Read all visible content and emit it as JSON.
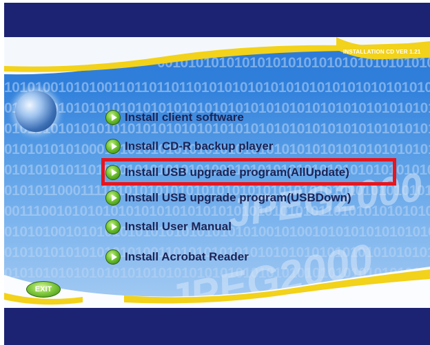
{
  "installer": {
    "version_label": "INSTALLATION CD VER 1.21",
    "watermark_text": "JPEG2000",
    "binary_lines": [
      "0010101010101010101010101010101010101010101010",
      "1010100101010011011011011010101010101010101010101010101010",
      "010101010101010101010101010101010101010101010101010101010101",
      "010101010101010101010101010101010101010101010101010101010101",
      "010101010100010101010101010101010101010101010101010101010101",
      "010101010110101010101010101000101010101010101010101010101010",
      "010101100011110101010101010101010101010101010101010101010101",
      "001110010101010101010101010101010101010101101010101010101010",
      "010101001010101010101010101010101001010010101010101010101010",
      "010101010101010101001101010101010101010101010101010101010101",
      "010101010101010101010101010101010101010101010101010101010101"
    ],
    "menu": [
      {
        "label": "Install client software"
      },
      {
        "label": "Install CD-R backup player"
      },
      {
        "label": "Install USB upgrade program(AllUpdate)"
      },
      {
        "label": "Install USB upgrade program(USBDown)"
      },
      {
        "label": "Install User Manual"
      },
      {
        "label": "Install Acrobat Reader"
      }
    ],
    "exit_label": "EXIT",
    "colors": {
      "navy": "#1d2373",
      "panel_blue": "#2f7fdb",
      "text": "#1c2456",
      "highlight": "#e8151d",
      "yellow": "#f2d21a"
    },
    "icons": {
      "menu_button": "green-play-arrow-icon",
      "logo": "globe-icon"
    }
  }
}
